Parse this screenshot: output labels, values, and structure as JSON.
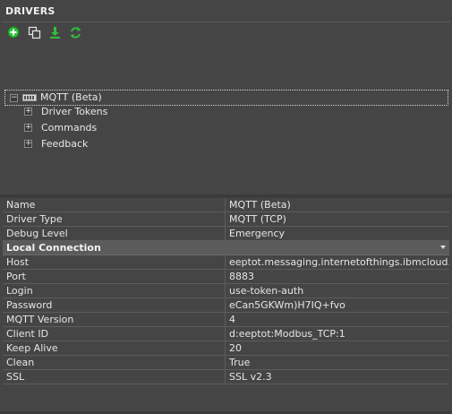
{
  "panel": {
    "title": "DRIVERS"
  },
  "toolbar": {
    "buttons": [
      {
        "icon": "add-icon",
        "color": "#2fbf3a"
      },
      {
        "icon": "duplicate-icon",
        "color": "#e6e6e6"
      },
      {
        "icon": "download-icon",
        "color": "#2fbf3a"
      },
      {
        "icon": "refresh-icon",
        "color": "#2fbf3a"
      }
    ]
  },
  "tree": {
    "root": {
      "label": "MQTT (Beta)",
      "expanded": true
    },
    "children": [
      {
        "label": "Driver Tokens"
      },
      {
        "label": "Commands"
      },
      {
        "label": "Feedback"
      }
    ]
  },
  "properties": {
    "general": [
      {
        "name": "Name",
        "value": "MQTT (Beta)"
      },
      {
        "name": "Driver Type",
        "value": "MQTT (TCP)"
      },
      {
        "name": "Debug Level",
        "value": "Emergency"
      }
    ],
    "section_title": "Local Connection",
    "connection": [
      {
        "name": "Host",
        "value": "eeptot.messaging.internetofthings.ibmcloud.com"
      },
      {
        "name": "Port",
        "value": "8883"
      },
      {
        "name": "Login",
        "value": "use-token-auth"
      },
      {
        "name": "Password",
        "value": "eCan5GKWm)H7IQ+fvo"
      },
      {
        "name": "MQTT Version",
        "value": "4"
      },
      {
        "name": "Client ID",
        "value": "d:eeptot:Modbus_TCP:1"
      },
      {
        "name": "Keep Alive",
        "value": "20"
      },
      {
        "name": "Clean",
        "value": "True"
      },
      {
        "name": "SSL",
        "value": "SSL v2.3"
      }
    ]
  }
}
